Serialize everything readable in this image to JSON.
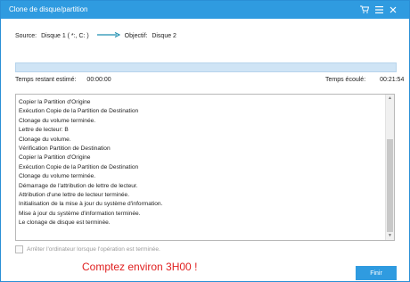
{
  "window": {
    "title": "Clone de disque/partition",
    "title_icons": [
      "cart-icon",
      "menu-icon",
      "close-icon"
    ]
  },
  "source_line": {
    "source_label": "Source:",
    "source_value": "Disque 1 ( *:, C: )",
    "target_label": "Objectif:",
    "target_value": "Disque 2"
  },
  "progress": {
    "fraction": 1.0
  },
  "time": {
    "remaining_label": "Temps restant estimé:",
    "remaining_value": "00:00:00",
    "elapsed_label": "Temps écoulé:",
    "elapsed_value": "00:21:54"
  },
  "log_lines": [
    "Copier la Partition d'Origine",
    "Exécution Copie de la Partition de Destination",
    "Clonage du volume terminée.",
    "Lettre de lecteur: B",
    "Clonage du volume.",
    "Vérification Partition de Destination",
    "Copier la Partition d'Origine",
    "Exécution Copie de la Partition de Destination",
    "Clonage du volume terminée.",
    "Démarrage de l'attribution de lettre de lecteur.",
    "Attribution d'une lettre de lecteur terminée.",
    "Initialisation de la mise à jour du système d'information.",
    "Mise à jour du système d'information terminée.",
    "Le clonage de disque est terminée."
  ],
  "checkbox_label": "Arrêter l'ordinateur lorsque l'opération est terminée.",
  "annotation": "Comptez environ 3H00 !",
  "finish_button": "Finir",
  "colors": {
    "accent": "#2f9be0",
    "annotation": "#e02020"
  }
}
